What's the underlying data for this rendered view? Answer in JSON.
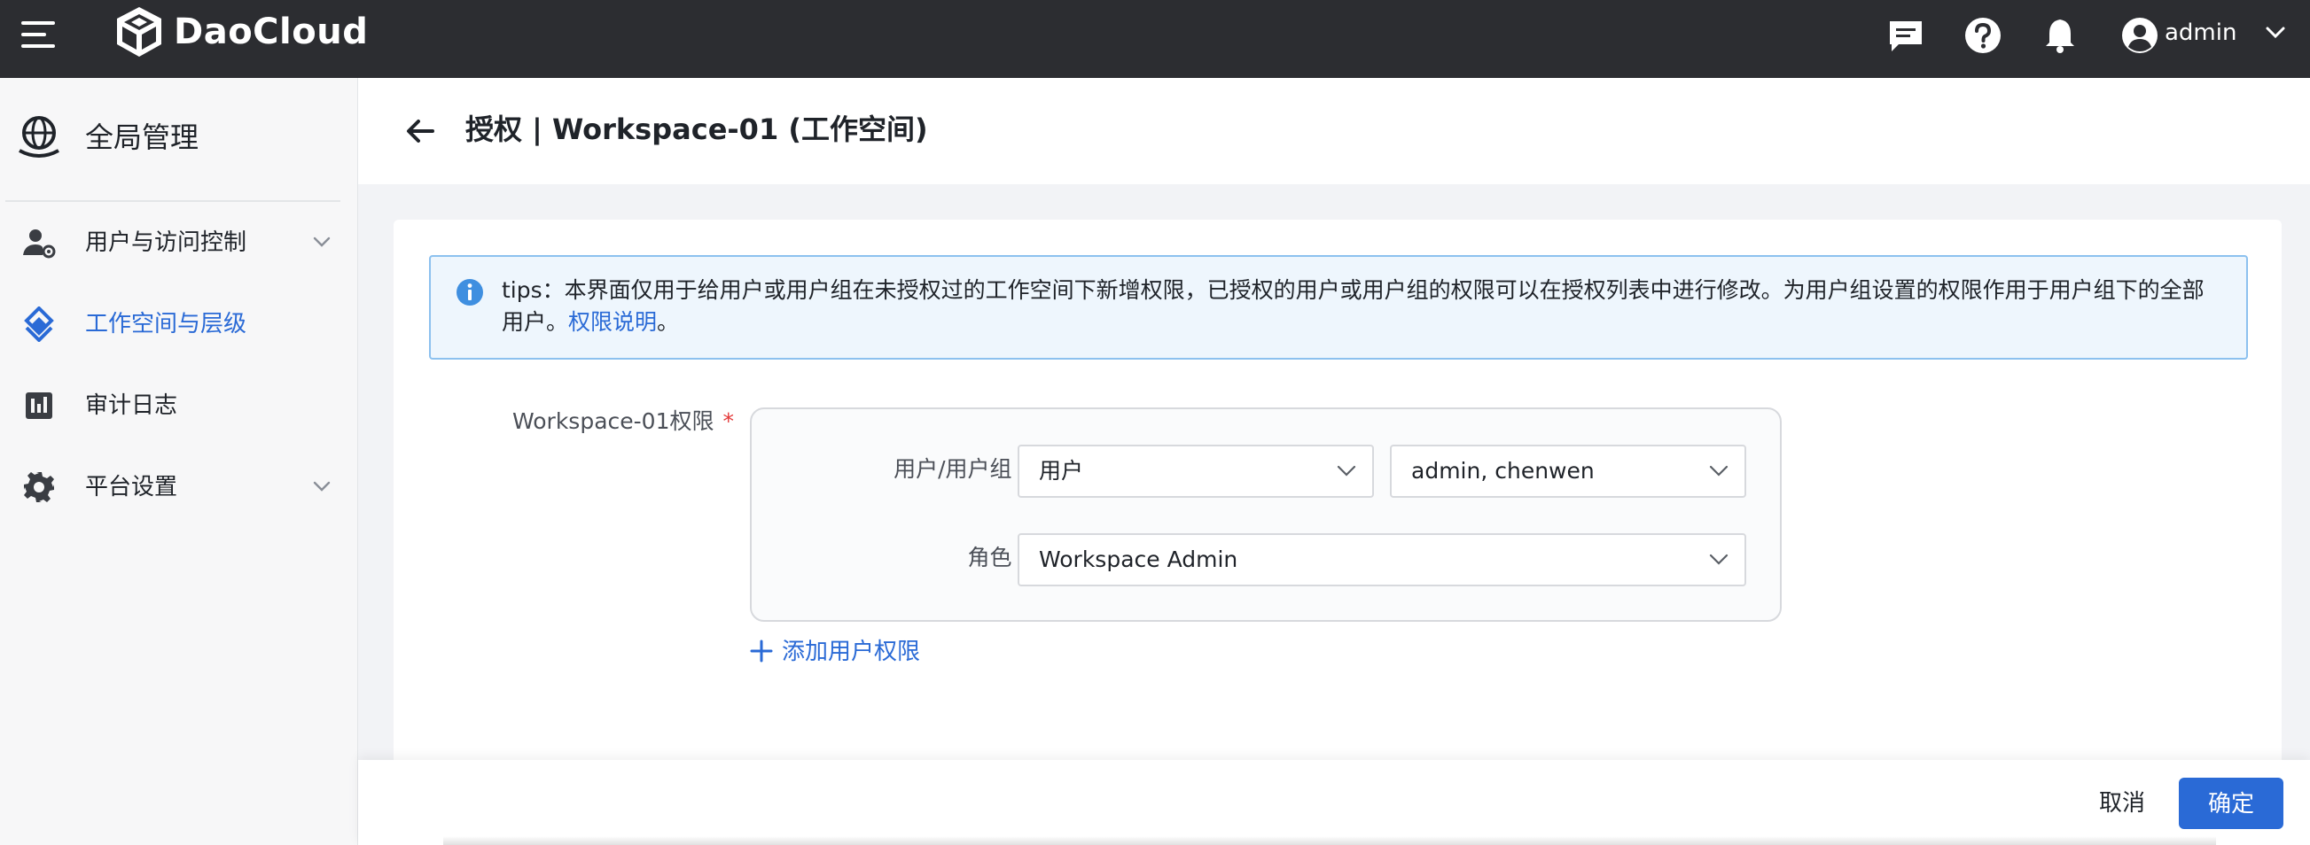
{
  "topbar": {
    "brand": "DaoCloud",
    "icons": [
      "menu-icon",
      "logo-icon",
      "message-icon",
      "help-icon",
      "bell-icon",
      "user-avatar-icon",
      "chevron-down-icon"
    ],
    "user_name": "admin"
  },
  "sidebar": {
    "title": "全局管理",
    "items": [
      {
        "label": "用户与访问控制",
        "icon": "user-gear-icon",
        "expandable": true,
        "active": false
      },
      {
        "label": "工作空间与层级",
        "icon": "workspace-diamond-icon",
        "expandable": false,
        "active": true
      },
      {
        "label": "审计日志",
        "icon": "audit-chart-icon",
        "expandable": false,
        "active": false
      },
      {
        "label": "平台设置",
        "icon": "gear-icon",
        "expandable": true,
        "active": false
      }
    ]
  },
  "header": {
    "title": "授权 | Workspace-01 (工作空间)"
  },
  "tips": {
    "text": "tips：本界面仅用于给用户或用户组在未授权过的工作空间下新增权限，已授权的用户或用户组的权限可以在授权列表中进行修改。为用户组设置的权限作用于用户组下的全部用户。",
    "link": "权限说明",
    "end": "。"
  },
  "form": {
    "permission_label": "Workspace-01权限",
    "required_mark": "*",
    "user_group_label": "用户/用户组",
    "user_type_value": "用户",
    "users_value": "admin, chenwen",
    "role_label": "角色",
    "role_value": "Workspace Admin",
    "add_permission": "添加用户权限"
  },
  "footer": {
    "cancel": "取消",
    "confirm": "确定"
  },
  "colors": {
    "topbar": "#2c2d31",
    "accent": "#2a6ad6",
    "required": "#e43a3a",
    "tips_bg": "#eef6fd",
    "tips_border": "#8cc1ef"
  }
}
